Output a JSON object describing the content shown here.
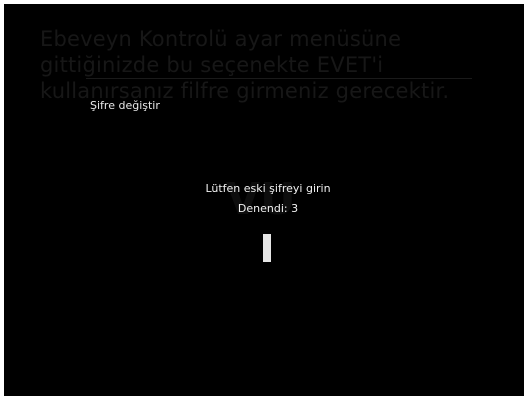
{
  "background_caption": "Ebeveyn Kontrolü ayar menüsüne gittiğinizde bu seçenekte EVET'i kullanırsanız filfre girmeniz gerecektir.",
  "menu": {
    "change_pin_label": "Şifre değiştir"
  },
  "dialog": {
    "prompt": "Lütfen eski şifreyi girin",
    "attempts": "Denendi: 3"
  },
  "colors": {
    "screen_bg": "#000000",
    "text": "#f2f2f2",
    "ghost_text": "#171717"
  }
}
